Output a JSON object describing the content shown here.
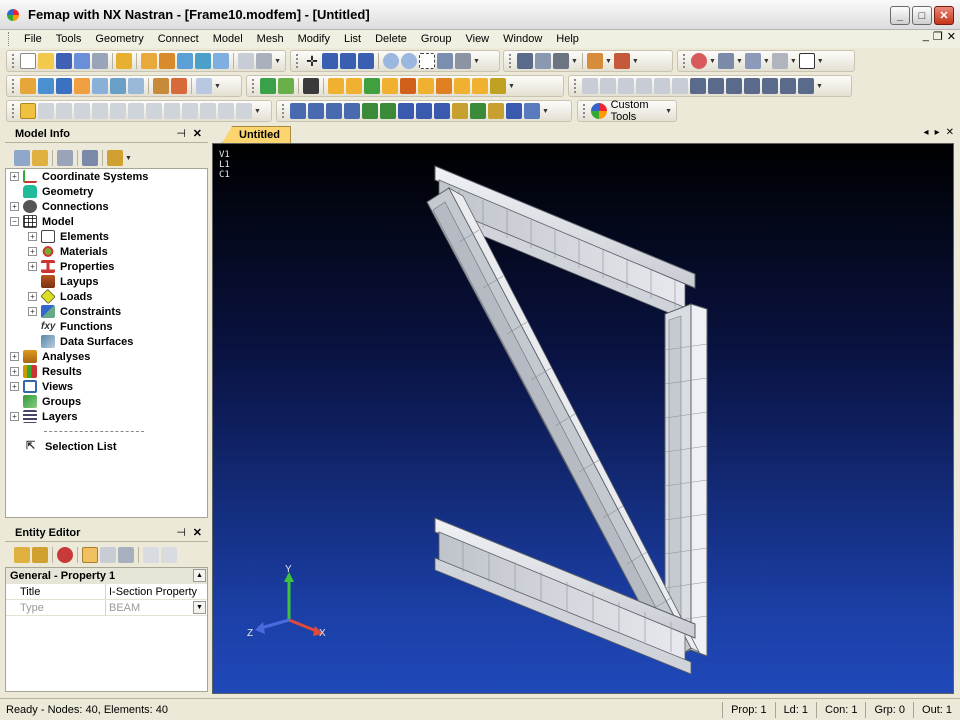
{
  "window": {
    "title": "Femap with NX Nastran - [Frame10.modfem] - [Untitled]",
    "controls": {
      "minimize": "_",
      "maximize": "□",
      "close": "✕"
    }
  },
  "menubar": {
    "items": [
      "File",
      "Tools",
      "Geometry",
      "Connect",
      "Model",
      "Mesh",
      "Modify",
      "List",
      "Delete",
      "Group",
      "View",
      "Window",
      "Help"
    ],
    "mdi_controls": [
      "_",
      "❐",
      "✕"
    ]
  },
  "toolbars": {
    "custom_tools_label": "Custom Tools"
  },
  "model_info": {
    "title": "Model Info",
    "pin": "⊣",
    "close": "✕",
    "tree": [
      {
        "label": "Coordinate Systems",
        "icon": "axes-icon",
        "color": "#3a3"
      },
      {
        "label": "Geometry",
        "icon": "cylinder-icon",
        "color": "#2b9"
      },
      {
        "label": "Connections",
        "icon": "connection-icon",
        "color": "#555"
      },
      {
        "label": "Model",
        "icon": "model-grid-icon",
        "color": "#444"
      },
      {
        "label": "Elements",
        "icon": "grid-icon",
        "color": "#444"
      },
      {
        "label": "Materials",
        "icon": "material-icon",
        "color": "#7a3"
      },
      {
        "label": "Properties",
        "icon": "ibeam-icon",
        "color": "#c33"
      },
      {
        "label": "Layups",
        "icon": "layers-book-icon",
        "color": "#b52"
      },
      {
        "label": "Loads",
        "icon": "load-icon",
        "color": "#dd2"
      },
      {
        "label": "Constraints",
        "icon": "constraint-icon",
        "color": "#36c"
      },
      {
        "label": "Functions",
        "icon": "function-icon",
        "color": "#444"
      },
      {
        "label": "Data Surfaces",
        "icon": "data-surface-icon",
        "color": "#58a"
      },
      {
        "label": "Analyses",
        "icon": "analysis-icon",
        "color": "#d92"
      },
      {
        "label": "Results",
        "icon": "results-icon",
        "color": "#c90"
      },
      {
        "label": "Views",
        "icon": "view-icon",
        "color": "#36a"
      },
      {
        "label": "Groups",
        "icon": "groups-icon",
        "color": "#393"
      },
      {
        "label": "Layers",
        "icon": "layers-icon",
        "color": "#446"
      },
      {
        "label": "Selection List",
        "icon": "selection-cursor-icon",
        "color": "#333"
      }
    ]
  },
  "entity_editor": {
    "title": "Entity Editor",
    "pin": "⊣",
    "close": "✕",
    "section": "General - Property 1",
    "rows": [
      {
        "key": "Title",
        "value": "I-Section Property"
      },
      {
        "key": "Type",
        "value": "BEAM"
      }
    ]
  },
  "document": {
    "tab": "Untitled",
    "nav": [
      "◂",
      "▸",
      "✕"
    ],
    "view_labels": [
      "V1",
      "L1",
      "C1"
    ],
    "axes": {
      "x": "X",
      "y": "Y",
      "z": "Z"
    }
  },
  "statusbar": {
    "message": "Ready - Nodes: 40,  Elements: 40",
    "cells": [
      "Prop: 1",
      "Ld: 1",
      "Con: 1",
      "Grp: 0",
      "Out: 1"
    ]
  },
  "colors": {
    "viewport_top": "#000000",
    "viewport_bottom": "#1f48b8",
    "beam_face": "#d6d9de",
    "beam_edge": "#5b5f66",
    "tab_active": "#fcd571"
  }
}
